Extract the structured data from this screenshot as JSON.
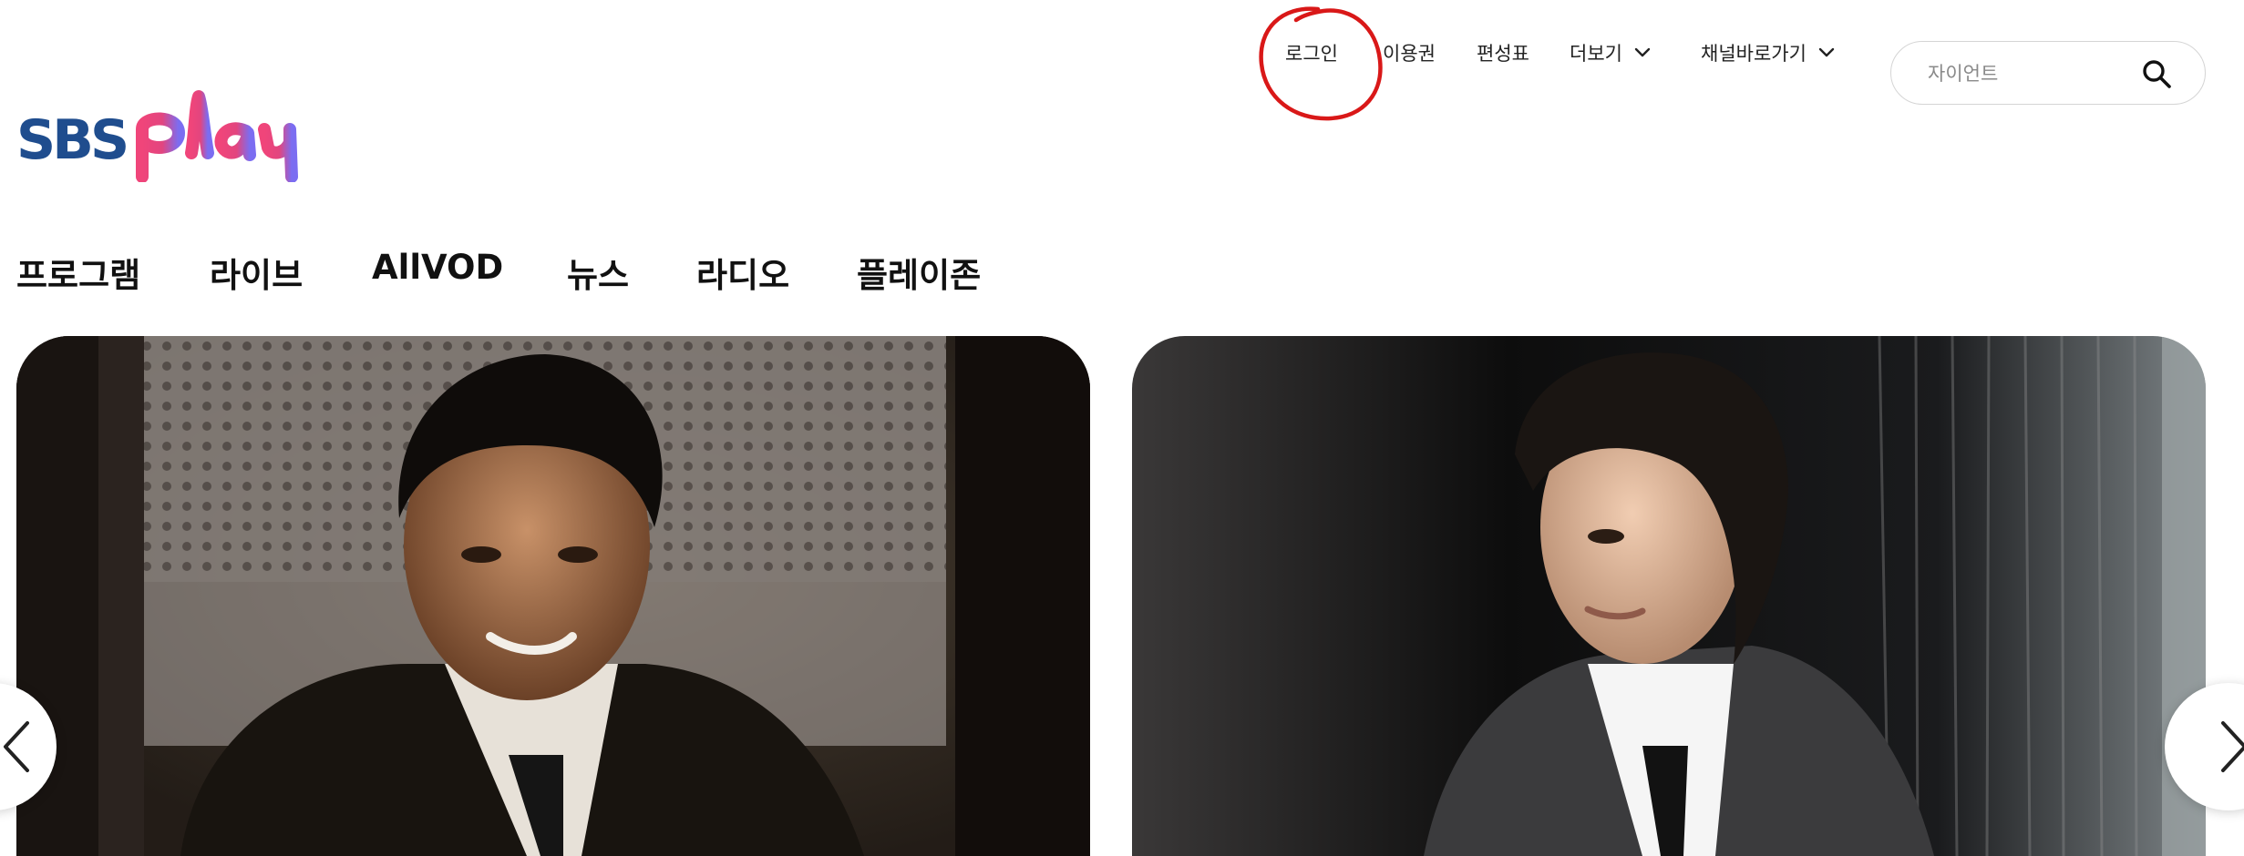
{
  "header": {
    "logo_icon": "sbs-play-logo",
    "utility_nav": {
      "login": "로그인",
      "pass": "이용권",
      "schedule": "편성표",
      "more": "더보기",
      "channels": "채널바로가기"
    },
    "search": {
      "placeholder": "자이언트",
      "icon": "search-icon"
    }
  },
  "main_nav": {
    "items": [
      "프로그램",
      "라이브",
      "AllVOD",
      "뉴스",
      "라디오",
      "플레이존"
    ]
  },
  "carousel": {
    "cards": [
      {
        "image": "drama-still-older-man-smiling"
      },
      {
        "image": "drama-still-young-man-profile"
      }
    ],
    "prev_icon": "chevron-left-icon",
    "next_icon": "chevron-right-icon"
  },
  "colors": {
    "annotation": "#d91818",
    "sbs_blue": "#1f4d8e",
    "play_pink": "#e8447a",
    "play_purple": "#7a6cf0"
  }
}
